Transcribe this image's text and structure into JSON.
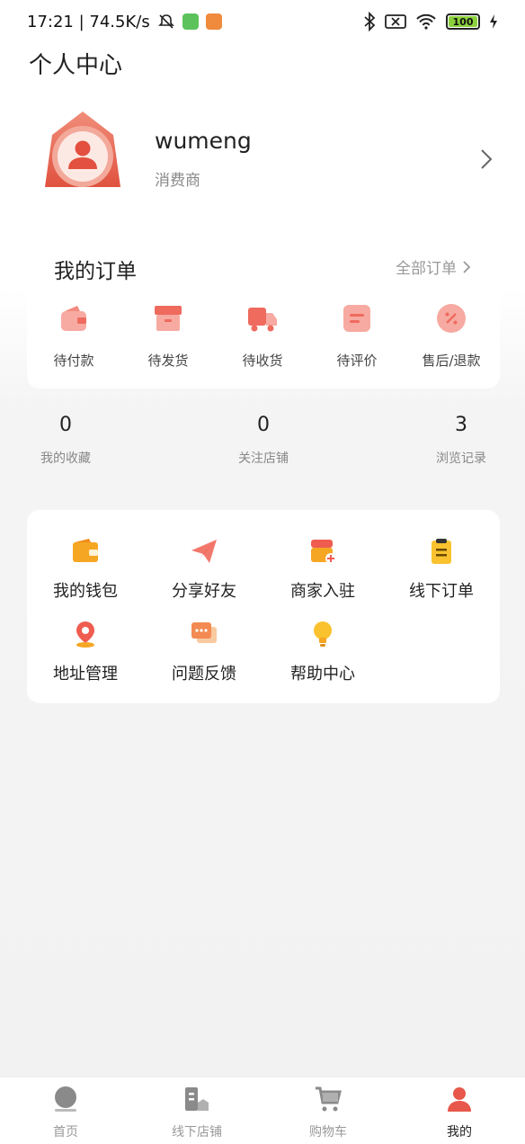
{
  "status_bar": {
    "time_speed": "17:21 | 74.5K/s",
    "battery": "100"
  },
  "page_title": "个人中心",
  "profile": {
    "username": "wumeng",
    "role": "消费商"
  },
  "orders": {
    "title": "我的订单",
    "all_label": "全部订单",
    "items": [
      {
        "label": "待付款",
        "icon": "wallet-icon"
      },
      {
        "label": "待发货",
        "icon": "box-icon"
      },
      {
        "label": "待收货",
        "icon": "truck-icon"
      },
      {
        "label": "待评价",
        "icon": "comment-icon"
      },
      {
        "label": "售后/退款",
        "icon": "refund-icon"
      }
    ]
  },
  "stats": [
    {
      "value": "0",
      "label": "我的收藏"
    },
    {
      "value": "0",
      "label": "关注店铺"
    },
    {
      "value": "3",
      "label": "浏览记录"
    }
  ],
  "services": [
    {
      "label": "我的钱包",
      "icon": "wallet-icon"
    },
    {
      "label": "分享好友",
      "icon": "paper-plane-icon"
    },
    {
      "label": "商家入驻",
      "icon": "store-join-icon"
    },
    {
      "label": "线下订单",
      "icon": "clipboard-icon"
    },
    {
      "label": "地址管理",
      "icon": "location-pin-icon"
    },
    {
      "label": "问题反馈",
      "icon": "chat-icon"
    },
    {
      "label": "帮助中心",
      "icon": "lightbulb-icon"
    }
  ],
  "bottom_nav": [
    {
      "label": "首页",
      "icon": "home-icon"
    },
    {
      "label": "线下店铺",
      "icon": "shop-icon"
    },
    {
      "label": "购物车",
      "icon": "cart-icon"
    },
    {
      "label": "我的",
      "icon": "user-icon",
      "active": true
    }
  ],
  "colors": {
    "accent_red": "#e8574b",
    "order_icon_pink": "#f7a8a0",
    "service_orange": "#f5a623",
    "service_red": "#ef5d50"
  }
}
